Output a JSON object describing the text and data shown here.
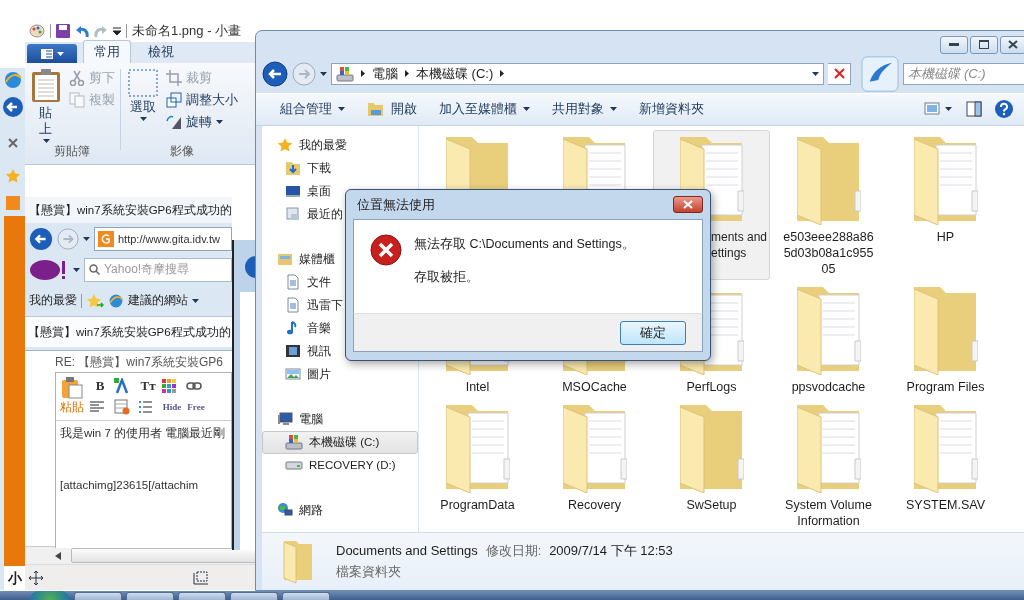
{
  "left_window": {
    "bottom_text": "小"
  },
  "paint": {
    "title": "未命名1.png - 小畫",
    "tabs": [
      {
        "label": "常用",
        "selected": true
      },
      {
        "label": "檢視",
        "selected": false
      }
    ],
    "paste": "貼上",
    "clipboard_tools": [
      {
        "label": "剪下",
        "disabled": true
      },
      {
        "label": "複製",
        "disabled": true
      }
    ],
    "clipboard_group": "剪貼簿",
    "select": "選取",
    "image_tools": [
      {
        "label": "裁剪",
        "disabled": true,
        "kind": "crop",
        "dropdown": false
      },
      {
        "label": "調整大小",
        "disabled": false,
        "kind": "resize",
        "dropdown": false
      },
      {
        "label": "旋轉",
        "disabled": false,
        "kind": "rotate",
        "dropdown": true
      }
    ],
    "image_group": "影像"
  },
  "browser": {
    "title": "【懸賞】win7系統安裝GP6程式成功的",
    "address": "http://www.gita.idv.tw",
    "search_placeholder": "Yahoo!奇摩搜尋",
    "favorites": "我的最愛",
    "suggested_sites": "建議的網站",
    "tab": "【懸賞】win7系統安裝GP6程式成功的"
  },
  "post": {
    "subject": "RE: 【懸賞】win7系統安裝GP6",
    "paste": "粘貼",
    "toolbar": [
      {
        "kind": "text",
        "label": "B"
      },
      {
        "kind": "font-color"
      },
      {
        "kind": "text",
        "label": "Tт"
      },
      {
        "kind": "color-grid"
      },
      {
        "kind": "link"
      },
      {
        "kind": "align"
      },
      {
        "kind": "table"
      },
      {
        "kind": "list"
      },
      {
        "kind": "text",
        "label": "Hide"
      },
      {
        "kind": "text",
        "label": "Free"
      }
    ],
    "body": [
      "我是win 7 的使用者 電腦最近剛",
      "[attachimg]23615[/attachim"
    ]
  },
  "explorer": {
    "breadcrumb": [
      "電腦",
      "本機磁碟 (C:)"
    ],
    "search_placeholder": "本機磁碟 (C:)",
    "commands": [
      {
        "label": "組合管理",
        "kind": "menu"
      },
      {
        "label": "開啟",
        "kind": "open"
      },
      {
        "label": "加入至媒體櫃",
        "kind": "menu"
      },
      {
        "label": "共用對象",
        "kind": "menu"
      },
      {
        "label": "新增資料夾",
        "kind": "plain"
      }
    ],
    "nav": [
      {
        "label": "我的最愛",
        "kind": "star",
        "selected": false,
        "children": [
          {
            "label": "下載",
            "kind": "download",
            "selected": false
          },
          {
            "label": "桌面",
            "kind": "desktop",
            "selected": false
          },
          {
            "label": "最近的",
            "kind": "recent",
            "selected": false
          }
        ]
      },
      {
        "label": "媒體櫃",
        "kind": "library",
        "selected": false,
        "children": [
          {
            "label": "文件",
            "kind": "document",
            "selected": false
          },
          {
            "label": "迅雷下",
            "kind": "document",
            "selected": false
          },
          {
            "label": "音樂",
            "kind": "music",
            "selected": false
          },
          {
            "label": "視訊",
            "kind": "video",
            "selected": false
          },
          {
            "label": "圖片",
            "kind": "picture",
            "selected": false
          }
        ]
      },
      {
        "label": "電腦",
        "kind": "computer",
        "selected": false,
        "children": [
          {
            "label": "本機磁碟 (C:)",
            "kind": "drive",
            "selected": true
          },
          {
            "label": "RECOVERY (D:)",
            "kind": "removable",
            "selected": false
          }
        ]
      },
      {
        "label": "網路",
        "kind": "network",
        "selected": false
      }
    ],
    "folders": [
      {
        "selected": false
      },
      {
        "selected": false
      },
      {
        "lines": [
          "ments and",
          "ettings"
        ],
        "selected": true
      },
      {
        "lines": [
          "e503eee288a86",
          "5d03b08a1c955",
          "05"
        ],
        "selected": false
      },
      {
        "lines": [
          "HP"
        ],
        "selected": false
      },
      {
        "lines": [
          "Intel"
        ],
        "selected": false
      },
      {
        "lines": [
          "MSOCache"
        ],
        "selected": false
      },
      {
        "lines": [
          "PerfLogs"
        ],
        "selected": false
      },
      {
        "lines": [
          "ppsvodcache"
        ],
        "selected": false
      },
      {
        "lines": [
          "Program Files"
        ],
        "selected": false
      },
      {
        "lines": [
          "ProgramData"
        ],
        "selected": false
      },
      {
        "lines": [
          "Recovery"
        ],
        "selected": false
      },
      {
        "lines": [
          "SwSetup"
        ],
        "selected": false
      },
      {
        "lines": [
          "System Volume",
          "Information"
        ],
        "selected": false
      },
      {
        "lines": [
          "SYSTEM.SAV"
        ],
        "selected": false
      }
    ],
    "details": {
      "name": "Documents and Settings",
      "date_label": "修改日期:",
      "date": "2009/7/14 下午 12:53",
      "type": "檔案資料夾"
    }
  },
  "dialog": {
    "title": "位置無法使用",
    "message": "無法存取 C:\\Documents and Settings。",
    "detail": "存取被拒。",
    "button": "確定"
  }
}
